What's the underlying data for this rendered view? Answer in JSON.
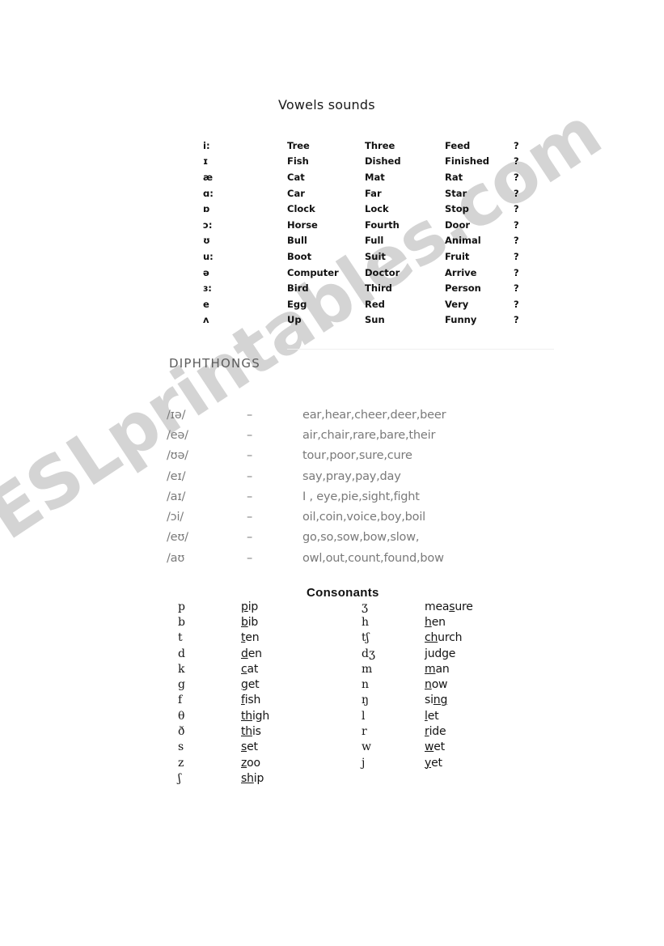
{
  "document": {
    "title": "Vowels sounds"
  },
  "watermark": {
    "text": "ESLprintables.com"
  },
  "vowels": {
    "rows": [
      {
        "symbol": "i:",
        "word1": "Tree",
        "word2": "Three",
        "word3": "Feed",
        "mark": "?"
      },
      {
        "symbol": "ɪ",
        "word1": "Fish",
        "word2": "Dished",
        "word3": "Finished",
        "mark": "?"
      },
      {
        "symbol": "æ",
        "word1": "Cat",
        "word2": "Mat",
        "word3": "Rat",
        "mark": "?"
      },
      {
        "symbol": "ɑ:",
        "word1": "Car",
        "word2": "Far",
        "word3": "Star",
        "mark": "?"
      },
      {
        "symbol": "ɒ",
        "word1": "Clock",
        "word2": "Lock",
        "word3": "Stop",
        "mark": "?"
      },
      {
        "symbol": "ɔ:",
        "word1": "Horse",
        "word2": "Fourth",
        "word3": "Door",
        "mark": "?"
      },
      {
        "symbol": "ʊ",
        "word1": "Bull",
        "word2": "Full",
        "word3": "Animal",
        "mark": "?"
      },
      {
        "symbol": "u:",
        "word1": "Boot",
        "word2": "Suit",
        "word3": "Fruit",
        "mark": "?"
      },
      {
        "symbol": "ə",
        "word1": "Computer",
        "word2": "Doctor",
        "word3": "Arrive",
        "mark": "?"
      },
      {
        "symbol": "ɜ:",
        "word1": "Bird",
        "word2": "Third",
        "word3": "Person",
        "mark": "?"
      },
      {
        "symbol": "e",
        "word1": "Egg",
        "word2": "Red",
        "word3": "Very",
        "mark": "?"
      },
      {
        "symbol": "ʌ",
        "word1": "Up",
        "word2": "Sun",
        "word3": "Funny",
        "mark": "?"
      }
    ]
  },
  "diphthongs": {
    "heading": "DIPHTHONGS",
    "rows": [
      {
        "symbol": "/ɪə/",
        "dash": "–",
        "examples": "ear,hear,cheer,deer,beer"
      },
      {
        "symbol": "/eə/",
        "dash": "–",
        "examples": "air,chair,rare,bare,their"
      },
      {
        "symbol": "/ʊə/",
        "dash": "–",
        "examples": "tour,poor,sure,cure"
      },
      {
        "symbol": "/eɪ/",
        "dash": "–",
        "examples": "say,pray,pay,day"
      },
      {
        "symbol": "/aɪ/",
        "dash": "–",
        "examples": "I , eye,pie,sight,fight"
      },
      {
        "symbol": "/ɔi/",
        "dash": "–",
        "examples": "oil,coin,voice,boy,boil"
      },
      {
        "symbol": "/eʊ/",
        "dash": "–",
        "examples": "go,so,sow,bow,slow,"
      },
      {
        "symbol": "/aʊ",
        "dash": "–",
        "examples": "owl,out,count,found,bow"
      }
    ]
  },
  "consonants": {
    "heading": "Consonants",
    "left": [
      {
        "symbol": "p",
        "pre": "",
        "hl": "p",
        "post": "ip"
      },
      {
        "symbol": "b",
        "pre": "",
        "hl": "b",
        "post": "ib"
      },
      {
        "symbol": "t",
        "pre": "",
        "hl": "t",
        "post": "en"
      },
      {
        "symbol": "d",
        "pre": "",
        "hl": "d",
        "post": "en"
      },
      {
        "symbol": "k",
        "pre": "",
        "hl": "c",
        "post": "at"
      },
      {
        "symbol": "g",
        "pre": "",
        "hl": "g",
        "post": "et"
      },
      {
        "symbol": "f",
        "pre": "",
        "hl": "f",
        "post": "ish"
      },
      {
        "symbol": "θ",
        "pre": "",
        "hl": "th",
        "post": "igh"
      },
      {
        "symbol": "ð",
        "pre": "",
        "hl": "th",
        "post": "is"
      },
      {
        "symbol": "s",
        "pre": "",
        "hl": "s",
        "post": "et"
      },
      {
        "symbol": "z",
        "pre": "",
        "hl": "z",
        "post": "oo"
      },
      {
        "symbol": "ʃ",
        "pre": "",
        "hl": "sh",
        "post": "ip"
      }
    ],
    "right": [
      {
        "symbol": "ʒ",
        "pre": "mea",
        "hl": "s",
        "post": "ure"
      },
      {
        "symbol": "h",
        "pre": "",
        "hl": "h",
        "post": "en"
      },
      {
        "symbol": "tʃ",
        "pre": "",
        "hl": "ch",
        "post": "urch"
      },
      {
        "symbol": "dʒ",
        "pre": "",
        "hl": "j",
        "post": "udge"
      },
      {
        "symbol": "m",
        "pre": "",
        "hl": "m",
        "post": "an"
      },
      {
        "symbol": "n",
        "pre": "",
        "hl": "n",
        "post": "ow"
      },
      {
        "symbol": "ŋ",
        "pre": "si",
        "hl": "ng",
        "post": ""
      },
      {
        "symbol": "l",
        "pre": "",
        "hl": "l",
        "post": "et"
      },
      {
        "symbol": "r",
        "pre": "",
        "hl": "r",
        "post": "ide"
      },
      {
        "symbol": "w",
        "pre": "",
        "hl": "w",
        "post": "et"
      },
      {
        "symbol": "j",
        "pre": "",
        "hl": "y",
        "post": "et"
      }
    ]
  }
}
